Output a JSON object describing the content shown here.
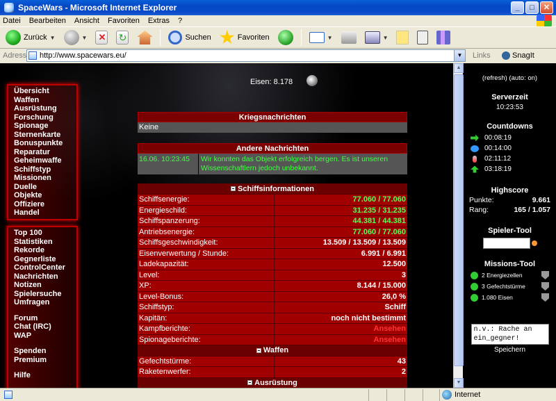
{
  "window": {
    "title": "SpaceWars - Microsoft Internet Explorer"
  },
  "menu": [
    "Datei",
    "Bearbeiten",
    "Ansicht",
    "Favoriten",
    "Extras",
    "?"
  ],
  "toolbar": {
    "back": "Zurück",
    "search": "Suchen",
    "favorites": "Favoriten"
  },
  "address": {
    "label": "Adresse",
    "url": "http://www.spacewars.eu/",
    "links": "Links",
    "snagit": "SnagIt"
  },
  "nav": {
    "group1": [
      "Übersicht",
      "Waffen",
      "Ausrüstung",
      "Forschung",
      "Spionage",
      "Sternenkarte",
      "Bonuspunkte",
      "Reparatur",
      "Geheimwaffe",
      "Schiffstyp",
      "Missionen",
      "Duelle",
      "Objekte",
      "Offiziere",
      "Handel"
    ],
    "group2": [
      "Top 100",
      "Statistiken",
      "Rekorde",
      "Gegnerliste",
      "ControlCenter",
      "Nachrichten",
      "Notizen",
      "Spielersuche",
      "Umfragen"
    ],
    "group3": [
      "Forum",
      "Chat (IRC)",
      "WAP"
    ],
    "group4": [
      "Spenden",
      "Premium"
    ],
    "group5": [
      "Hilfe"
    ]
  },
  "resources": {
    "label": "Eisen:",
    "value": "8.178"
  },
  "war_news": {
    "title": "Kriegsnachrichten",
    "body": "Keine"
  },
  "other_news": {
    "title": "Andere Nachrichten",
    "date": "16.06. 10:23:45",
    "text": "Wir konnten das Objekt erfolgreich bergen. Es ist unseren Wissenschaftlern jedoch unbekannt."
  },
  "ship_info": {
    "title": "Schiffsinformationen",
    "rows": [
      {
        "k": "Schiffsenergie:",
        "v": "77.060 / 77.060",
        "c": "green"
      },
      {
        "k": "Energieschild:",
        "v": "31.235 / 31.235",
        "c": "green"
      },
      {
        "k": "Schiffspanzerung:",
        "v": "44.381 / 44.381",
        "c": "green"
      },
      {
        "k": "Antriebsenergie:",
        "v": "77.060 / 77.060",
        "c": "green"
      },
      {
        "k": "Schiffsgeschwindigkeit:",
        "v": "13.509 / 13.509 / 13.509",
        "c": ""
      },
      {
        "k": "Eisenverwertung / Stunde:",
        "v": "6.991 / 6.991",
        "c": ""
      },
      {
        "k": "Ladekapazität:",
        "v": "12.500",
        "c": ""
      },
      {
        "k": "Level:",
        "v": "3",
        "c": ""
      },
      {
        "k": "XP:",
        "v": "8.144 / 15.000",
        "c": ""
      },
      {
        "k": "Level-Bonus:",
        "v": "26,0 %",
        "c": ""
      },
      {
        "k": "Schiffstyp:",
        "v": "Schiff",
        "c": ""
      },
      {
        "k": "Kapitän:",
        "v": "noch nicht bestimmt",
        "c": ""
      },
      {
        "k": "Kampfberichte:",
        "v": "Ansehen",
        "c": "red"
      },
      {
        "k": "Spionageberichte:",
        "v": "Ansehen",
        "c": "red"
      }
    ],
    "weapons_title": "Waffen",
    "weapons": [
      {
        "k": "Gefechtstürme:",
        "v": "43"
      },
      {
        "k": "Raketenwerfer:",
        "v": "2"
      }
    ],
    "equipment_title": "Ausrüstung"
  },
  "sidebar": {
    "refresh": "(refresh)  (auto: on)",
    "server_time_title": "Serverzeit",
    "server_time": "10:23:53",
    "countdowns_title": "Countdowns",
    "countdowns": [
      "00:08:19",
      "00:14:00",
      "02:11:12",
      "03:18:19"
    ],
    "highscore_title": "Highscore",
    "points_label": "Punkte:",
    "points": "9.661",
    "rank_label": "Rang:",
    "rank": "165 / 1.057",
    "player_tool_title": "Spieler-Tool",
    "mission_tool_title": "Missions-Tool",
    "missions": [
      "2 Energiezellen",
      "3 Gefechtstürme",
      "1.080 Eisen"
    ],
    "note_text": "n.v.: Rache an ein_gegner!",
    "save_label": "Speichern"
  },
  "status": {
    "zone": "Internet"
  }
}
